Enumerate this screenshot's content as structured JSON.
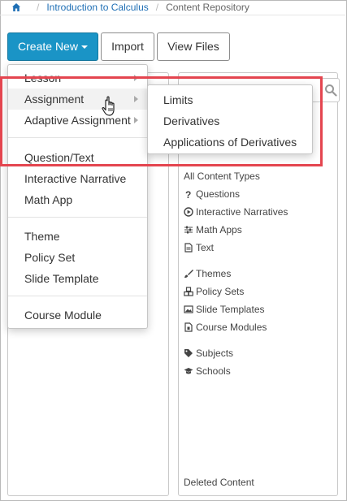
{
  "breadcrumb": {
    "home_icon": "home-icon",
    "items": [
      {
        "label": "Introduction to Calculus",
        "link": true
      },
      {
        "label": "Content Repository",
        "link": false
      }
    ]
  },
  "toolbar": {
    "create_new_label": "Create New",
    "import_label": "Import",
    "view_files_label": "View Files"
  },
  "create_menu": {
    "items": [
      {
        "label": "Lesson",
        "has_submenu": true
      },
      {
        "label": "Assignment",
        "has_submenu": true,
        "hovered": true
      },
      {
        "label": "Adaptive Assignment",
        "has_submenu": true
      },
      {
        "label": "Question/Text"
      },
      {
        "label": "Interactive Narrative"
      },
      {
        "label": "Math App"
      },
      {
        "label": "Theme"
      },
      {
        "label": "Policy Set"
      },
      {
        "label": "Slide Template"
      },
      {
        "label": "Course Module"
      }
    ]
  },
  "assignment_submenu": {
    "items": [
      "Limits",
      "Derivatives",
      "Applications of Derivatives"
    ]
  },
  "filters": {
    "all_label": "All Content Types",
    "types": [
      {
        "label": "Questions",
        "icon": "question-icon"
      },
      {
        "label": "Interactive Narratives",
        "icon": "play-circle-icon"
      },
      {
        "label": "Math Apps",
        "icon": "sliders-icon"
      },
      {
        "label": "Text",
        "icon": "document-icon"
      }
    ],
    "design": [
      {
        "label": "Themes",
        "icon": "brush-icon"
      },
      {
        "label": "Policy Sets",
        "icon": "cubes-icon"
      },
      {
        "label": "Slide Templates",
        "icon": "image-icon"
      },
      {
        "label": "Course Modules",
        "icon": "module-icon"
      }
    ],
    "taxonomy": [
      {
        "label": "Subjects",
        "icon": "tag-icon"
      },
      {
        "label": "Schools",
        "icon": "graduation-cap-icon"
      }
    ],
    "deleted_label": "Deleted Content"
  },
  "colors": {
    "primary_button": "#1a94c6",
    "link": "#1f6fb5",
    "highlight_outline": "#e4454f"
  }
}
